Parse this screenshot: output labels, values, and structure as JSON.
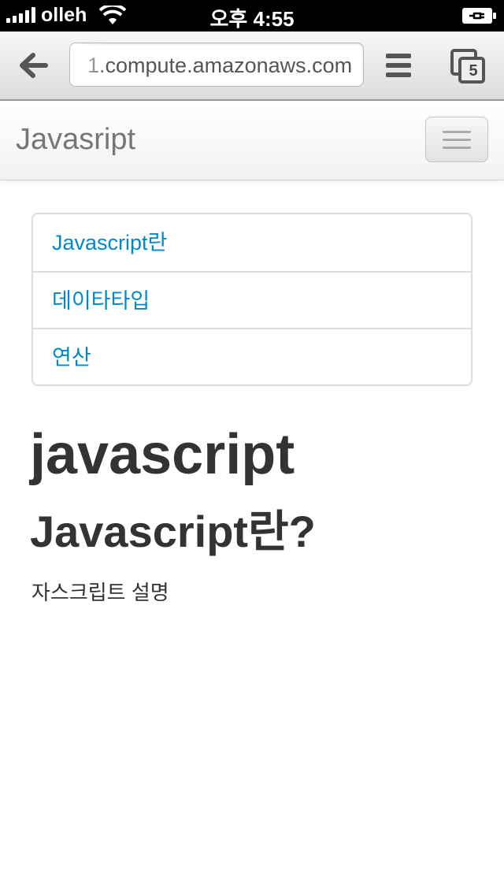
{
  "status_bar": {
    "carrier": "olleh",
    "time": "오후 4:55",
    "signal_icon": "signal-bars-icon",
    "wifi_icon": "wifi-icon",
    "battery_icon": "battery-charging-icon"
  },
  "browser": {
    "url": "1.compute.amazonaws.com",
    "tab_count": "5",
    "back_icon": "back-arrow-icon",
    "menu_icon": "menu-icon",
    "tabs_icon": "tabs-icon"
  },
  "navbar": {
    "brand": "Javasript",
    "toggle_icon": "hamburger-icon"
  },
  "nav_list": {
    "items": [
      {
        "label": "Javascript란"
      },
      {
        "label": "데이타타입"
      },
      {
        "label": "연산"
      }
    ]
  },
  "content": {
    "title": "javascript",
    "section_title": "Javascript란?",
    "section_text": "자스크립트 설명"
  },
  "colors": {
    "link": "#0088cc",
    "heading": "#333333",
    "brand": "#777777"
  }
}
